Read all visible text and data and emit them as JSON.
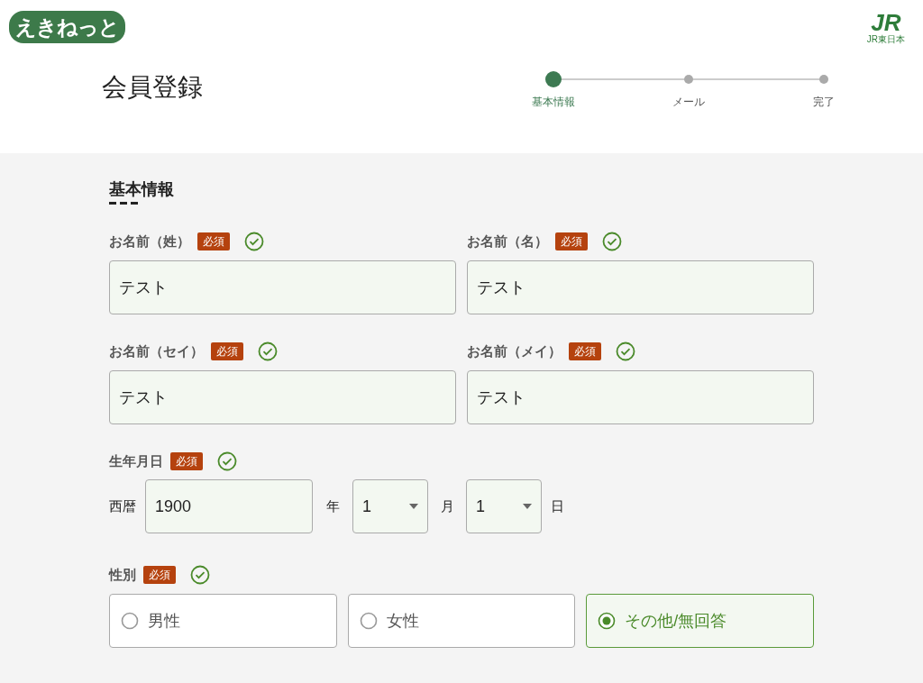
{
  "header": {
    "logo": "えきねっと",
    "brand_mark": "JR",
    "brand_caption": "JR東日本"
  },
  "page_title": "会員登録",
  "steps": [
    {
      "label": "基本情報",
      "selected": true
    },
    {
      "label": "メール",
      "selected": false
    },
    {
      "label": "完了",
      "selected": false
    }
  ],
  "section_title": "基本情報",
  "name_fields": [
    {
      "label": "お名前（姓）",
      "badge": "必須",
      "valid": true,
      "value": "テスト"
    },
    {
      "label": "お名前（名）",
      "badge": "必須",
      "valid": true,
      "value": "テスト"
    },
    {
      "label": "お名前（セイ）",
      "badge": "必須",
      "valid": true,
      "value": "テスト"
    },
    {
      "label": "お名前（メイ）",
      "badge": "必須",
      "valid": true,
      "value": "テスト"
    }
  ],
  "birthdate": {
    "label": "生年月日",
    "badge": "必須",
    "valid": true,
    "era_label": "西暦",
    "year": "1900",
    "year_unit": "年",
    "month": "1",
    "month_unit": "月",
    "day": "1",
    "day_unit": "日"
  },
  "gender": {
    "label": "性別",
    "badge": "必須",
    "valid": true,
    "options": [
      {
        "label": "男性",
        "selected": false
      },
      {
        "label": "女性",
        "selected": false
      },
      {
        "label": "その他/無回答",
        "selected": true
      }
    ]
  }
}
